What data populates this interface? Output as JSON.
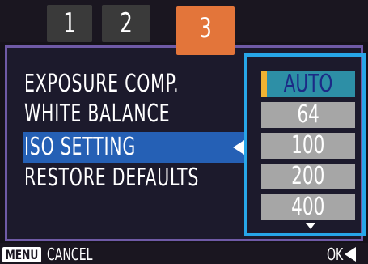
{
  "tabs": [
    {
      "label": "1"
    },
    {
      "label": "2"
    },
    {
      "label": "3"
    }
  ],
  "active_tab": "3",
  "menu": {
    "items": [
      {
        "label": "EXPOSURE COMP."
      },
      {
        "label": "WHITE BALANCE"
      },
      {
        "label": "ISO SETTING"
      },
      {
        "label": "RESTORE DEFAULTS"
      }
    ],
    "selected": "ISO SETTING"
  },
  "iso_options": {
    "items": [
      {
        "label": "AUTO"
      },
      {
        "label": "64"
      },
      {
        "label": "100"
      },
      {
        "label": "200"
      },
      {
        "label": "400"
      }
    ],
    "selected": "AUTO"
  },
  "footer": {
    "menu_key": "MENU",
    "cancel_label": "CANCEL",
    "ok_label": "OK"
  },
  "colors": {
    "active_tab": "#e3753a",
    "highlight": "#2560b5",
    "options_frame": "#27a6e8",
    "selected_option": "#2d8fa6",
    "selection_marker": "#f0b232",
    "panel_border": "#6f5aa6"
  },
  "icons": {
    "submenu_arrow": "triangle-left-icon",
    "more_options": "triangle-down-icon",
    "ok_arrow": "triangle-left-icon"
  }
}
